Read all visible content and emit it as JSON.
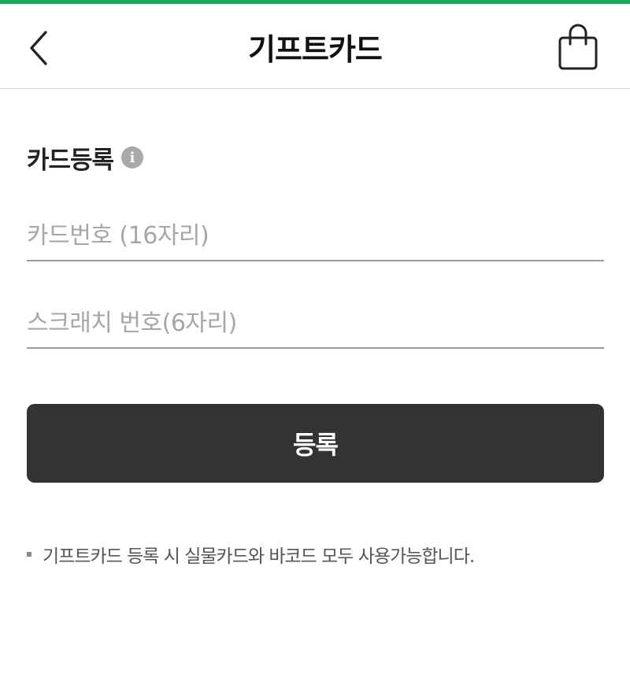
{
  "colors": {
    "accent": "#1aa55a",
    "button_bg": "#333333",
    "placeholder": "#a6a6a6"
  },
  "header": {
    "title": "기프트카드",
    "back_icon": "chevron-left-icon",
    "bag_icon": "shopping-bag-icon"
  },
  "section": {
    "title": "카드등록",
    "info_icon": "info-icon",
    "info_glyph": "i"
  },
  "form": {
    "card_number_placeholder": "카드번호 (16자리)",
    "card_number_value": "",
    "scratch_number_placeholder": "스크래치 번호(6자리)",
    "scratch_number_value": "",
    "submit_label": "등록"
  },
  "notice": {
    "text": "기프트카드 등록 시 실물카드와 바코드 모두 사용가능합니다."
  }
}
